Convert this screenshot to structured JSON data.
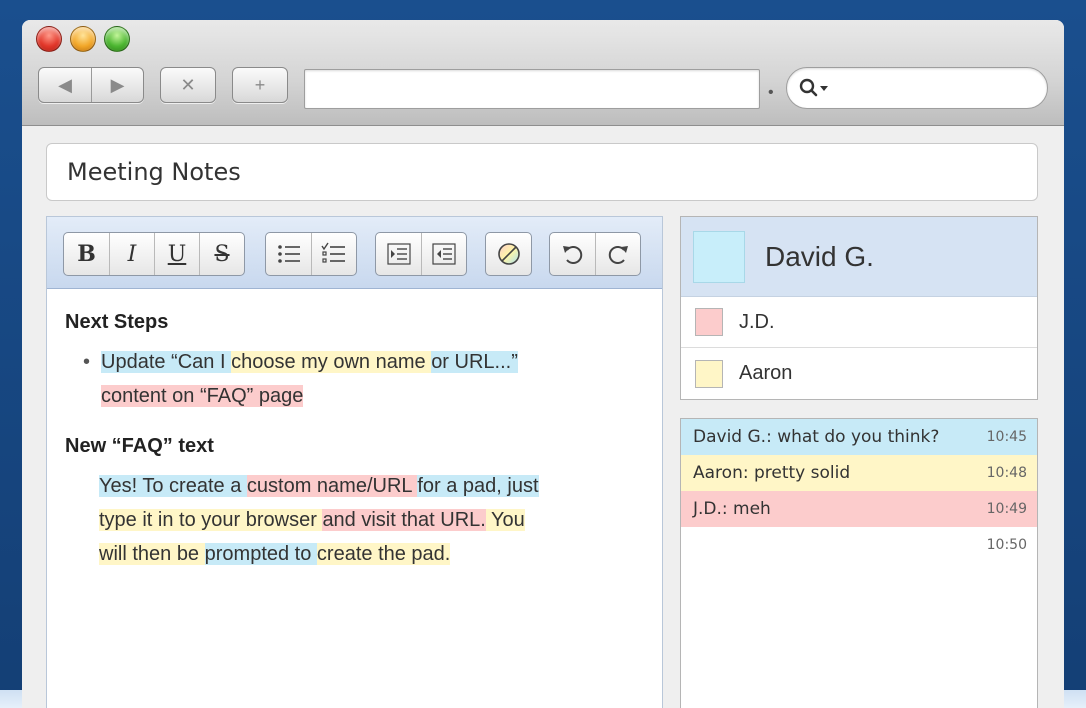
{
  "browser": {
    "url": "",
    "nav": {
      "back": "◀",
      "forward": "▶",
      "stop": "✕",
      "new_tab": "+"
    }
  },
  "pad": {
    "title": "Meeting Notes"
  },
  "toolbar": {
    "bold": "B",
    "italic": "I",
    "underline": "U",
    "strike": "S"
  },
  "document": {
    "heading1": "Next Steps",
    "bullet": [
      {
        "text": "Update “Can I ",
        "color": "blue"
      },
      {
        "text": "choose my own name ",
        "color": "yellow"
      },
      {
        "text": "or URL...”",
        "color": "blue"
      },
      {
        "text": "content on “FAQ” page",
        "color": "red"
      }
    ],
    "heading2": "New “FAQ” text",
    "para": [
      {
        "text": "Yes! To create a ",
        "color": "blue"
      },
      {
        "text": "custom name/URL ",
        "color": "red"
      },
      {
        "text": "for a pad, just",
        "color": "blue"
      },
      {
        "text": "type it in to your browser ",
        "color": "yellow"
      },
      {
        "text": "and visit that URL.",
        "color": "red"
      },
      {
        "text": " You",
        "color": "yellow"
      },
      {
        "text": "will then be ",
        "color": "yellow"
      },
      {
        "text": "prompted to ",
        "color": "blue"
      },
      {
        "text": "create the pad.",
        "color": "yellow"
      }
    ]
  },
  "users": {
    "me": {
      "name": "David G.",
      "color": "#c8eefa"
    },
    "others": [
      {
        "name": "J.D.",
        "color": "#fccccc"
      },
      {
        "name": "Aaron",
        "color": "#fff6c7"
      }
    ]
  },
  "chat": {
    "messages": [
      {
        "text": "David G.: what do you think?",
        "time": "10:45",
        "color": "blue"
      },
      {
        "text": "Aaron: pretty solid",
        "time": "10:48",
        "color": "yellow"
      },
      {
        "text": "J.D.: meh",
        "time": "10:49",
        "color": "red"
      },
      {
        "text": "",
        "time": "10:50",
        "color": "none"
      }
    ]
  }
}
